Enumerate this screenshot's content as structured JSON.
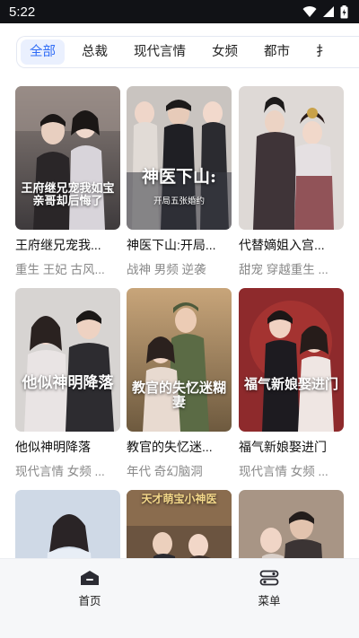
{
  "status_bar": {
    "time": "5:22"
  },
  "tabs": [
    {
      "label": "全部",
      "active": true
    },
    {
      "label": "总裁"
    },
    {
      "label": "现代言情"
    },
    {
      "label": "女频"
    },
    {
      "label": "都市"
    },
    {
      "label": "扌"
    }
  ],
  "cards": [
    {
      "title": "王府继兄宠我...",
      "tags": "重生 王妃 古风...",
      "cover_text": "王府继兄宠我如宝 亲哥却后悔了"
    },
    {
      "title": "神医下山:开局...",
      "tags": "战神 男频 逆袭",
      "cover_text": "神医下山:",
      "cover_subtext": "开局五张婚约"
    },
    {
      "title": "代替嫡姐入宫...",
      "tags": "甜宠 穿越重生 ..."
    },
    {
      "title": "他似神明降落",
      "tags": "现代言情 女频 ...",
      "cover_text": "他似神明降落"
    },
    {
      "title": "教官的失忆迷...",
      "tags": "年代 奇幻脑洞",
      "cover_text": "教官的失忆迷糊妻"
    },
    {
      "title": "福气新娘娶进门",
      "tags": "现代言情 女频 ...",
      "cover_text": "福气新娘娶进门"
    },
    {
      "title": "",
      "tags": ""
    },
    {
      "title": "",
      "tags": "",
      "cover_text": "天才萌宝小神医"
    },
    {
      "title": "",
      "tags": ""
    }
  ],
  "bottom_nav": {
    "home": {
      "label": "首页"
    },
    "menu": {
      "label": "菜单"
    }
  },
  "colors": {
    "accent": "#2f6cf6",
    "tab_active_bg": "#eaf0fe",
    "tag_gray": "#888888"
  }
}
